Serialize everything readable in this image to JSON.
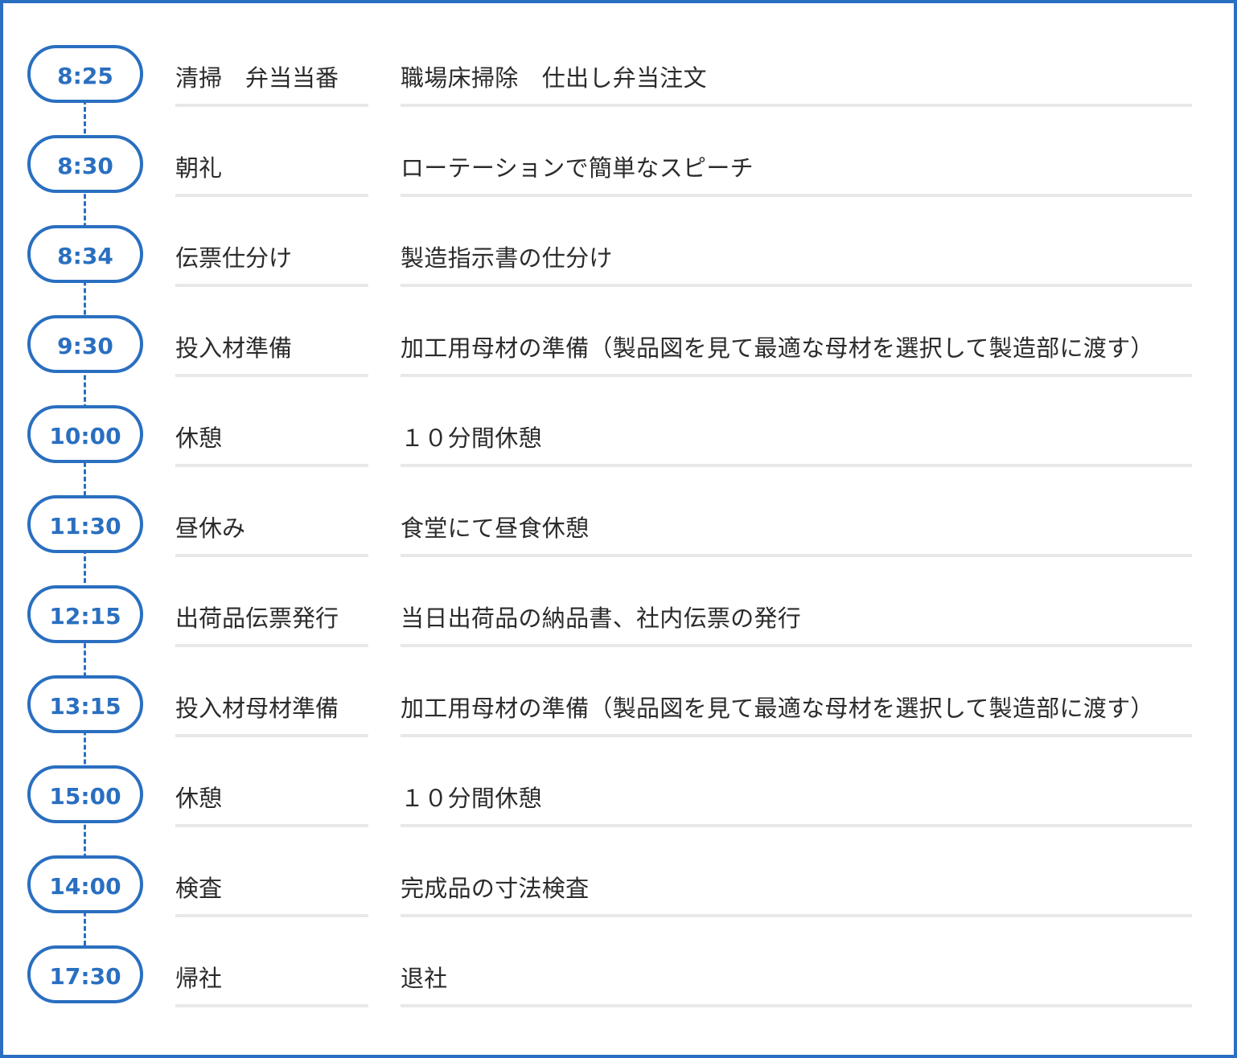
{
  "schedule": [
    {
      "time": "8:25",
      "task": "清掃　弁当当番",
      "desc": "職場床掃除　仕出し弁当注文"
    },
    {
      "time": "8:30",
      "task": "朝礼",
      "desc": "ローテーションで簡単なスピーチ"
    },
    {
      "time": "8:34",
      "task": "伝票仕分け",
      "desc": "製造指示書の仕分け"
    },
    {
      "time": "9:30",
      "task": "投入材準備",
      "desc": "加工用母材の準備（製品図を見て最適な母材を選択して製造部に渡す）"
    },
    {
      "time": "10:00",
      "task": "休憩",
      "desc": "１０分間休憩"
    },
    {
      "time": "11:30",
      "task": "昼休み",
      "desc": "食堂にて昼食休憩"
    },
    {
      "time": "12:15",
      "task": "出荷品伝票発行",
      "desc": "当日出荷品の納品書、社内伝票の発行"
    },
    {
      "time": "13:15",
      "task": "投入材母材準備",
      "desc": "加工用母材の準備（製品図を見て最適な母材を選択して製造部に渡す）"
    },
    {
      "time": "15:00",
      "task": "休憩",
      "desc": "１０分間休憩"
    },
    {
      "time": "14:00",
      "task": "検査",
      "desc": "完成品の寸法検査"
    },
    {
      "time": "17:30",
      "task": "帰社",
      "desc": "退社"
    }
  ],
  "colors": {
    "accent": "#2a6fc0",
    "text": "#2b2b2b",
    "divider": "#e8e8e8"
  }
}
